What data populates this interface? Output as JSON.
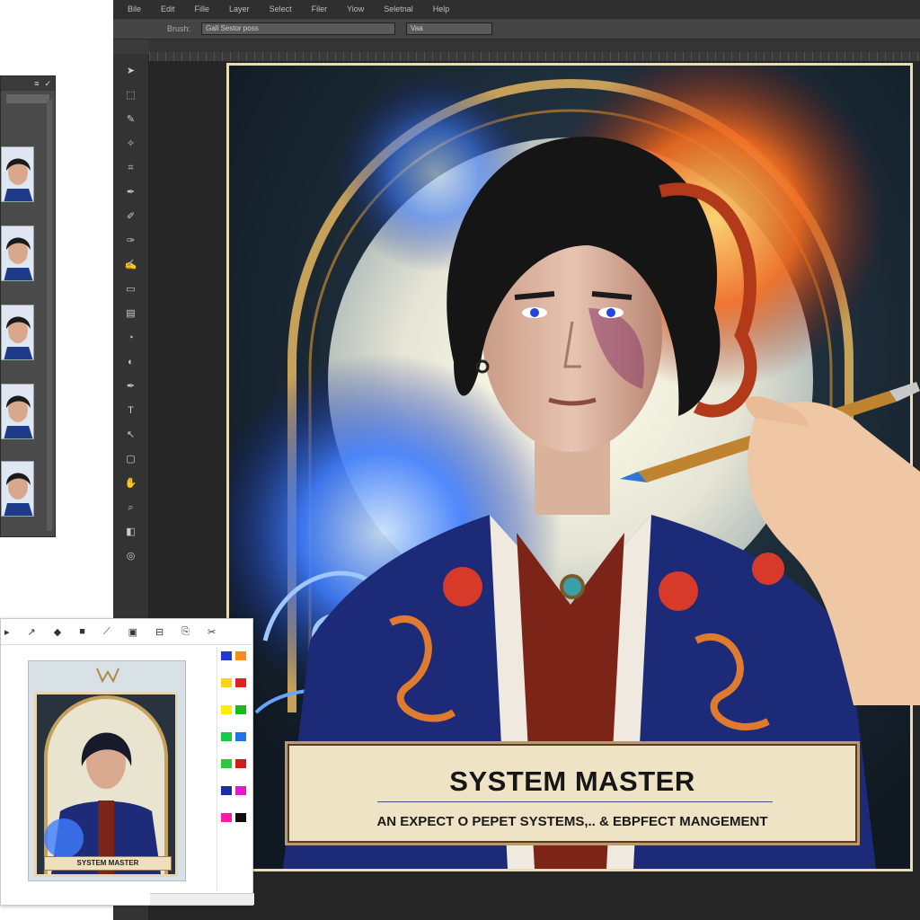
{
  "menubar": {
    "items": [
      "Bile",
      "Edit",
      "Fille",
      "Layer",
      "Select",
      "Filer",
      "Yiow",
      "Seletnal",
      "Help"
    ]
  },
  "optionsbar": {
    "label": "Brush:",
    "field_value": "Gall Sestor poss",
    "field2_value": "Vaa"
  },
  "canvas": {
    "banner_title": "SYSTEM MASTER",
    "banner_subtitle": "AN EXPECT O PEPET SYSTEMS,.. & EBPFECT MANGEMENT"
  },
  "mini": {
    "card_label": "SYSTEM MASTER",
    "tools": [
      "arrow-tool",
      "shape-tool",
      "color-tool",
      "pen-tool",
      "frame-tool",
      "crop-tool",
      "file-tool",
      "cut-tool"
    ]
  },
  "palette_colors": [
    "#1f3ad6",
    "#ff8a1a",
    "#ffd21a",
    "#e02222",
    "#ffee00",
    "#22b522",
    "#16c946",
    "#1c74e6",
    "#2cc840",
    "#d51a1a",
    "#1c2ca8",
    "#e41ac8",
    "#ff1aa8",
    "#0d0d0d"
  ],
  "colors": {
    "accent_blue": "#2a58e0",
    "fire": "#e8571e",
    "parchment": "#efe3c5",
    "frame_gold": "#c6a15a"
  }
}
